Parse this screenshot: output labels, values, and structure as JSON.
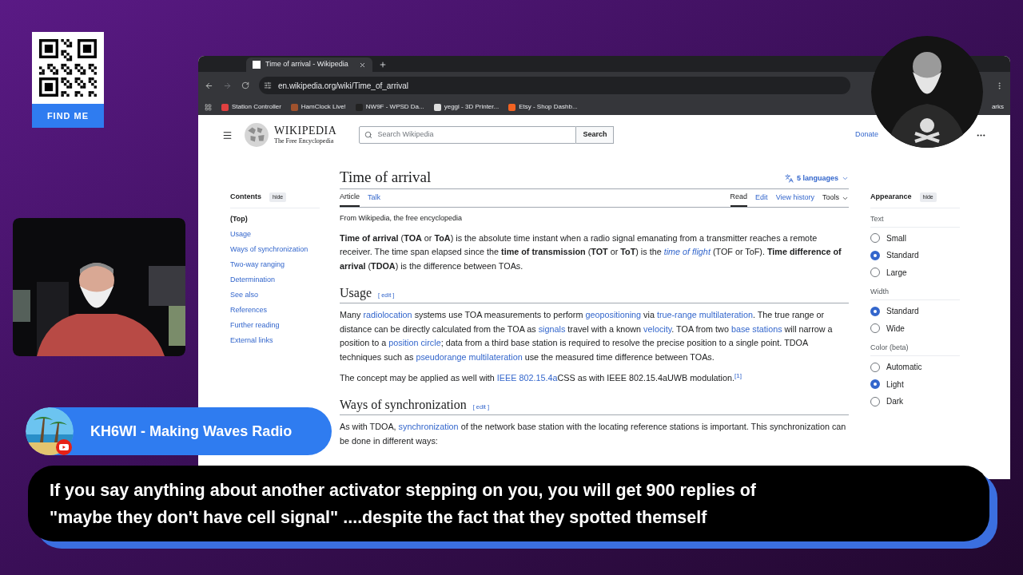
{
  "browser": {
    "tab": {
      "title": "Time of arrival - Wikipedia"
    },
    "url": "en.wikipedia.org/wiki/Time_of_arrival",
    "bookmarks": [
      {
        "label": "Station Controller"
      },
      {
        "label": "HamClock Live!"
      },
      {
        "label": "NW9F - WPSD Da..."
      },
      {
        "label": "yeggi - 3D Printer..."
      },
      {
        "label": "Etsy - Shop Dashb..."
      }
    ],
    "bookmarks_end": "arks"
  },
  "wiki": {
    "wordmark": "WIKIPEDIA",
    "tagline": "The Free Encyclopedia",
    "search_placeholder": "Search Wikipedia",
    "search_button": "Search",
    "donate": "Donate",
    "title": "Time of arrival",
    "languages": "5 languages",
    "page_tabs": [
      {
        "label": "Article",
        "selected": true
      },
      {
        "label": "Talk",
        "selected": false
      }
    ],
    "view_tabs": [
      {
        "label": "Read",
        "selected": true
      },
      {
        "label": "Edit",
        "selected": false
      },
      {
        "label": "View history",
        "selected": false
      }
    ],
    "tools": "Tools",
    "from": "From Wikipedia, the free encyclopedia",
    "contents": {
      "heading": "Contents",
      "hide": "hide",
      "items": [
        {
          "label": "(Top)",
          "selected": true
        },
        {
          "label": "Usage",
          "selected": false
        },
        {
          "label": "Ways of synchronization",
          "selected": false
        },
        {
          "label": "Two-way ranging",
          "selected": false
        },
        {
          "label": "Determination",
          "selected": false
        },
        {
          "label": "See also",
          "selected": false
        },
        {
          "label": "References",
          "selected": false
        },
        {
          "label": "Further reading",
          "selected": false
        },
        {
          "label": "External links",
          "selected": false
        }
      ]
    },
    "body": [
      {
        "kind": "paragraph",
        "segments": [
          {
            "kind": "bold",
            "t": "Time of arrival"
          },
          {
            "kind": "plain",
            "t": " ("
          },
          {
            "kind": "bold",
            "t": "TOA"
          },
          {
            "kind": "plain",
            "t": " or "
          },
          {
            "kind": "bold",
            "t": "ToA"
          },
          {
            "kind": "plain",
            "t": ") is the absolute time instant when a radio signal emanating from a transmitter reaches a remote receiver. The time span elapsed since the "
          },
          {
            "kind": "bold",
            "t": "time of transmission"
          },
          {
            "kind": "plain",
            "t": " ("
          },
          {
            "kind": "bold",
            "t": "TOT"
          },
          {
            "kind": "plain",
            "t": " or "
          },
          {
            "kind": "bold",
            "t": "ToT"
          },
          {
            "kind": "plain",
            "t": ") is the "
          },
          {
            "kind": "italic-link",
            "t": "time of flight"
          },
          {
            "kind": "plain",
            "t": " (TOF or ToF). "
          },
          {
            "kind": "bold",
            "t": "Time difference of arrival"
          },
          {
            "kind": "plain",
            "t": " ("
          },
          {
            "kind": "bold",
            "t": "TDOA"
          },
          {
            "kind": "plain",
            "t": ") is the difference between TOAs."
          }
        ]
      },
      {
        "kind": "heading",
        "text": "Usage",
        "edit": "[ edit ]"
      },
      {
        "kind": "paragraph",
        "segments": [
          {
            "kind": "plain",
            "t": "Many "
          },
          {
            "kind": "link",
            "t": "radiolocation"
          },
          {
            "kind": "plain",
            "t": " systems use TOA measurements to perform "
          },
          {
            "kind": "link",
            "t": "geopositioning"
          },
          {
            "kind": "plain",
            "t": " via "
          },
          {
            "kind": "link",
            "t": "true-range multilateration"
          },
          {
            "kind": "plain",
            "t": ". The true range or distance can be directly calculated from the TOA as "
          },
          {
            "kind": "link",
            "t": "signals"
          },
          {
            "kind": "plain",
            "t": " travel with a known "
          },
          {
            "kind": "link",
            "t": "velocity"
          },
          {
            "kind": "plain",
            "t": ". TOA from two "
          },
          {
            "kind": "link",
            "t": "base stations"
          },
          {
            "kind": "plain",
            "t": " will narrow a position to a "
          },
          {
            "kind": "link",
            "t": "position circle"
          },
          {
            "kind": "plain",
            "t": "; data from a third base station is required to resolve the precise position to a single point. TDOA techniques such as "
          },
          {
            "kind": "link",
            "t": "pseudorange multilateration"
          },
          {
            "kind": "plain",
            "t": " use the measured time difference between TOAs."
          }
        ]
      },
      {
        "kind": "paragraph",
        "segments": [
          {
            "kind": "plain",
            "t": "The concept may be applied as well with "
          },
          {
            "kind": "link",
            "t": "IEEE 802.15.4a"
          },
          {
            "kind": "plain",
            "t": "CSS as with IEEE 802.15.4aUWB modulation."
          },
          {
            "kind": "ref",
            "t": "[1]"
          }
        ]
      },
      {
        "kind": "heading",
        "text": "Ways of synchronization",
        "edit": "[ edit ]"
      },
      {
        "kind": "paragraph",
        "segments": [
          {
            "kind": "plain",
            "t": "As with TDOA, "
          },
          {
            "kind": "link",
            "t": "synchronization"
          },
          {
            "kind": "plain",
            "t": " of the network base station with the locating reference stations is important. This synchronization can be done in different ways:"
          }
        ]
      }
    ],
    "appearance": {
      "heading": "Appearance",
      "hide": "hide",
      "groups": [
        {
          "label": "Text",
          "options": [
            {
              "label": "Small",
              "selected": false
            },
            {
              "label": "Standard",
              "selected": true
            },
            {
              "label": "Large",
              "selected": false
            }
          ]
        },
        {
          "label": "Width",
          "options": [
            {
              "label": "Standard",
              "selected": true
            },
            {
              "label": "Wide",
              "selected": false
            }
          ]
        },
        {
          "label": "Color (beta)",
          "options": [
            {
              "label": "Automatic",
              "selected": false
            },
            {
              "label": "Light",
              "selected": true
            },
            {
              "label": "Dark",
              "selected": false
            }
          ]
        }
      ]
    }
  },
  "overlay": {
    "qr_label": "FIND ME",
    "banner": "KH6WI - Making Waves Radio",
    "caption": [
      "If you say anything about another activator stepping on you, you will get 900 replies of",
      "\"maybe they don't have cell signal\" ....despite the fact that they spotted themself"
    ]
  }
}
